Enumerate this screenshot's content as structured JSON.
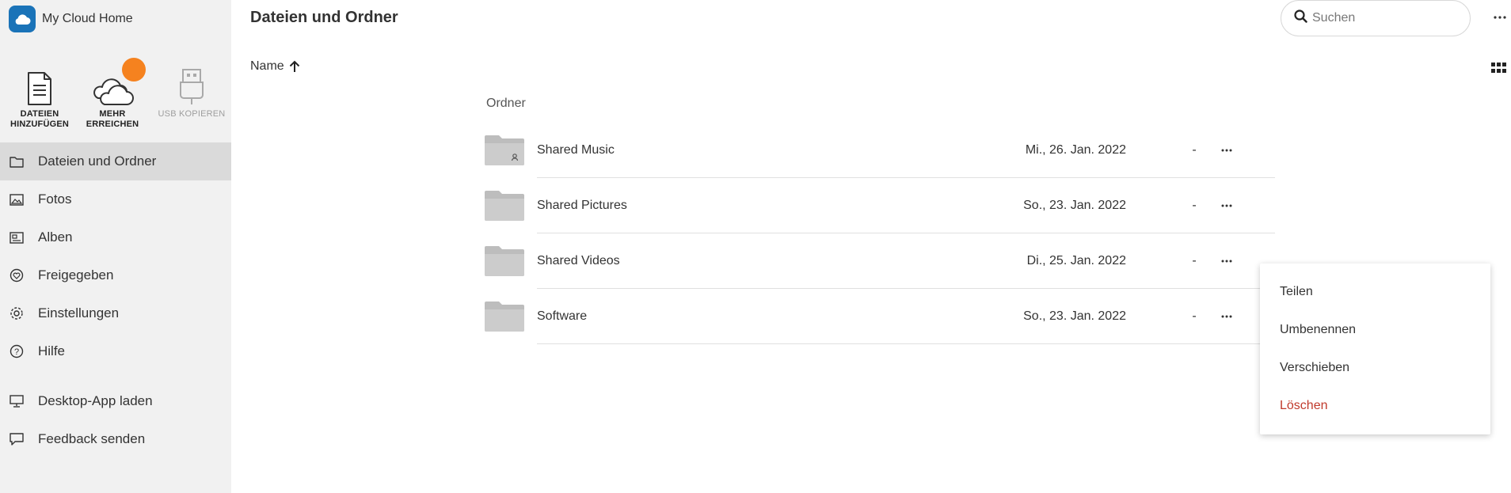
{
  "brand": {
    "name": "My Cloud Home",
    "color": "#1a73b8"
  },
  "quick_actions": [
    {
      "label_line1": "DATEIEN",
      "label_line2": "HINZUFÜGEN",
      "icon": "document-icon"
    },
    {
      "label_line1": "MEHR",
      "label_line2": "ERREICHEN",
      "icon": "cloud-icon"
    },
    {
      "label_line1": "USB KOPIEREN",
      "icon": "usb-icon",
      "disabled": true
    }
  ],
  "nav": {
    "items": [
      {
        "label": "Dateien und Ordner",
        "icon": "folder-outline-icon",
        "active": true
      },
      {
        "label": "Fotos",
        "icon": "photo-icon"
      },
      {
        "label": "Alben",
        "icon": "album-icon"
      },
      {
        "label": "Freigegeben",
        "icon": "shared-icon"
      },
      {
        "label": "Einstellungen",
        "icon": "gear-icon"
      },
      {
        "label": "Hilfe",
        "icon": "help-icon"
      }
    ],
    "bottom_items": [
      {
        "label": "Desktop-App laden",
        "icon": "monitor-icon"
      },
      {
        "label": "Feedback senden",
        "icon": "chat-icon"
      }
    ]
  },
  "header": {
    "title": "Dateien und Ordner",
    "search_placeholder": "Suchen"
  },
  "list": {
    "sort_label": "Name",
    "section_label": "Ordner",
    "rows": [
      {
        "name": "Shared Music",
        "date": "Mi., 26. Jan. 2022",
        "size": "-",
        "icon": "shared-folder-icon"
      },
      {
        "name": "Shared Pictures",
        "date": "So., 23. Jan. 2022",
        "size": "-",
        "icon": "folder-icon"
      },
      {
        "name": "Shared Videos",
        "date": "Di., 25. Jan. 2022",
        "size": "-",
        "icon": "folder-icon"
      },
      {
        "name": "Software",
        "date": "So., 23. Jan. 2022",
        "size": "-",
        "icon": "folder-icon"
      }
    ]
  },
  "context_menu": {
    "items": [
      {
        "label": "Teilen"
      },
      {
        "label": "Umbenennen"
      },
      {
        "label": "Verschieben"
      },
      {
        "label": "Löschen",
        "danger": true
      }
    ]
  },
  "colors": {
    "sidebar_bg": "#f1f1f1",
    "active_nav_bg": "#dadada",
    "badge": "#f5821f",
    "danger": "#c0392b",
    "folder": "#bdbdbd"
  }
}
